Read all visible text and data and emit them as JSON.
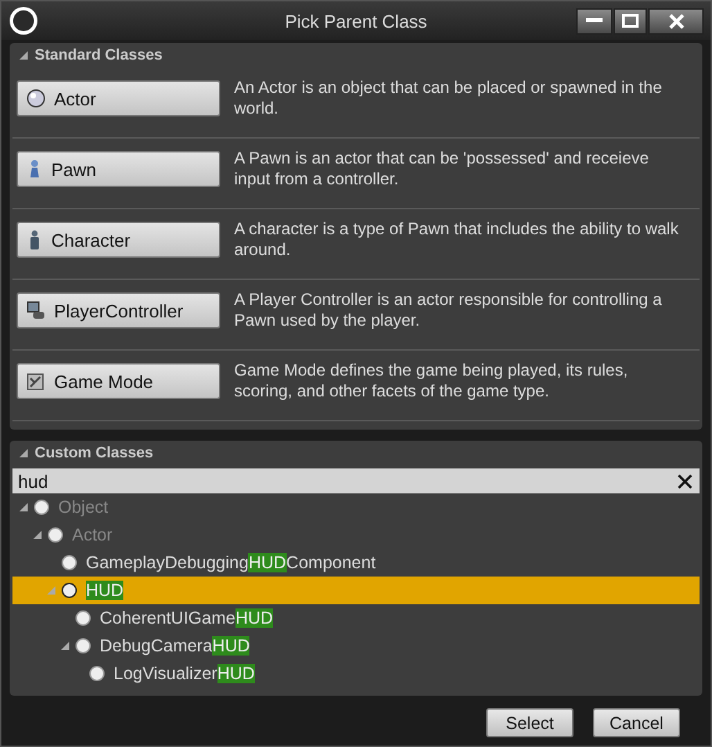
{
  "window": {
    "title": "Pick Parent Class"
  },
  "standard_classes": {
    "title": "Standard Classes",
    "expanded": true,
    "items": [
      {
        "label": "Actor",
        "description": "An Actor is an object that can be placed or spawned in the world."
      },
      {
        "label": "Pawn",
        "description": "A Pawn is an actor that can be 'possessed' and receieve input from a controller."
      },
      {
        "label": "Character",
        "description": "A character is a type of Pawn that includes the ability to walk around."
      },
      {
        "label": "PlayerController",
        "description": "A Player Controller is an actor responsible for controlling a Pawn used by the player."
      },
      {
        "label": "Game Mode",
        "description": "Game Mode defines the game being played, its rules, scoring, and other facets of the game type."
      }
    ]
  },
  "custom_classes": {
    "title": "Custom Classes",
    "expanded": true,
    "search": {
      "value": "hud"
    },
    "tree": [
      {
        "parts": [
          {
            "text": "Object",
            "highlighted": false
          }
        ],
        "greyed": true,
        "selected": false,
        "expanded": true,
        "children": [
          {
            "parts": [
              {
                "text": "Actor",
                "highlighted": false
              }
            ],
            "greyed": true,
            "selected": false,
            "expanded": true,
            "children": [
              {
                "parts": [
                  {
                    "text": "GameplayDebugging",
                    "highlighted": false
                  },
                  {
                    "text": "HUD",
                    "highlighted": true
                  },
                  {
                    "text": "Component",
                    "highlighted": false
                  }
                ],
                "greyed": false,
                "selected": false
              },
              {
                "parts": [
                  {
                    "text": "HUD",
                    "highlighted": true
                  }
                ],
                "greyed": false,
                "selected": true,
                "expanded": true,
                "children": [
                  {
                    "parts": [
                      {
                        "text": "CoherentUIGame",
                        "highlighted": false
                      },
                      {
                        "text": "HUD",
                        "highlighted": true
                      }
                    ],
                    "greyed": false,
                    "selected": false
                  },
                  {
                    "parts": [
                      {
                        "text": "DebugCamera",
                        "highlighted": false
                      },
                      {
                        "text": "HUD",
                        "highlighted": true
                      }
                    ],
                    "greyed": false,
                    "selected": false,
                    "expanded": true,
                    "children": [
                      {
                        "parts": [
                          {
                            "text": "LogVisualizer",
                            "highlighted": false
                          },
                          {
                            "text": "HUD",
                            "highlighted": true
                          }
                        ],
                        "greyed": false,
                        "selected": false
                      }
                    ]
                  }
                ]
              }
            ]
          }
        ]
      }
    ]
  },
  "buttons": [
    {
      "label": "Select"
    },
    {
      "label": "Cancel"
    }
  ]
}
